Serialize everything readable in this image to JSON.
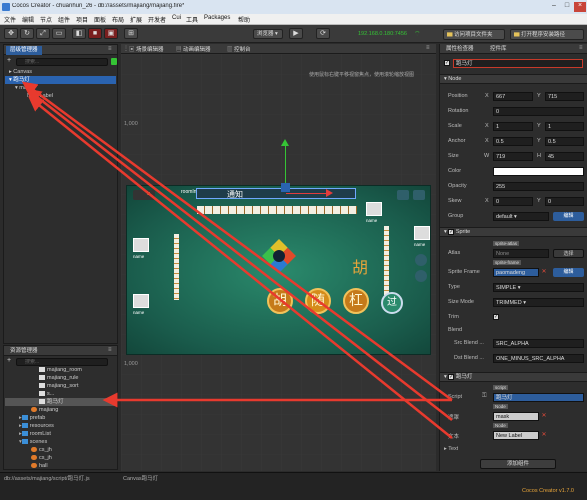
{
  "app": {
    "title": "Cocos Creator - chuanhun_26 - db://assets/majiang/majiang.fire*",
    "version": "Cocos Creator v1.7.0"
  },
  "menu": [
    "文件",
    "编辑",
    "节点",
    "组件",
    "项目",
    "面板",
    "布局",
    "扩展",
    "开发者",
    "Cui",
    "工具",
    "Packages",
    "帮助"
  ],
  "toolbar": {
    "browser_label": "浏览器",
    "ip": "192.168.0.180:7456",
    "open_project_label": "访问项目文件夹",
    "open_app_label": "打开程序安装路径"
  },
  "hierarchy": {
    "tab": "层级管理器",
    "search_placeholder": "搜索...",
    "nodes": [
      {
        "label": "Canvas",
        "indent": 0,
        "arrow": "▸"
      },
      {
        "label": "跑马灯",
        "indent": 0,
        "arrow": "▾",
        "selected": true
      },
      {
        "label": "mask",
        "indent": 1,
        "arrow": "▾"
      },
      {
        "label": "New Label",
        "indent": 2,
        "arrow": ""
      }
    ]
  },
  "assets": {
    "tab": "资源管理器",
    "search_placeholder": "搜索...",
    "items": [
      {
        "label": "majiang_room",
        "indent": 3,
        "kind": "script"
      },
      {
        "label": "majiang_rule",
        "indent": 3,
        "kind": "script"
      },
      {
        "label": "majiang_sort",
        "indent": 3,
        "kind": "script"
      },
      {
        "label": "s...",
        "indent": 3,
        "kind": "script"
      },
      {
        "label": "跑马灯",
        "indent": 3,
        "kind": "script",
        "selected": true
      },
      {
        "label": "majiang",
        "indent": 2,
        "kind": "fire"
      },
      {
        "label": "prefab",
        "indent": 1,
        "kind": "folder"
      },
      {
        "label": "resources",
        "indent": 1,
        "kind": "folder"
      },
      {
        "label": "roomList",
        "indent": 1,
        "kind": "folder"
      },
      {
        "label": "scenes",
        "indent": 1,
        "kind": "folder-open"
      },
      {
        "label": "cs_jh",
        "indent": 2,
        "kind": "fire"
      },
      {
        "label": "cs_jh",
        "indent": 2,
        "kind": "fire"
      },
      {
        "label": "hall",
        "indent": 2,
        "kind": "fire"
      }
    ],
    "path": "db://assets/majiang/script/跑马灯.js"
  },
  "scene": {
    "tabs": [
      "场景编辑器",
      "动画编辑器",
      "控制台"
    ],
    "hint": "使用鼠标右键平移视窗焦点，使用滚轮缩放视图",
    "axis_label": "1,000",
    "axis_label_2": "1,000",
    "notice": "通知",
    "canvas_label": "Canvas跑马灯",
    "score_labels": [
      "5",
      "name",
      "name",
      "name",
      "name"
    ],
    "game_labels": [
      "胡",
      "随",
      "杠",
      "胡",
      "过"
    ],
    "room_info": "roomInfo"
  },
  "inspector": {
    "tabs": [
      "属性检查器",
      "控件库"
    ],
    "node_name": "跑马灯",
    "section_node": "Node",
    "position": {
      "x": "667",
      "y": "715"
    },
    "rotation": "0",
    "scale": {
      "x": "1",
      "y": "1"
    },
    "anchor": {
      "x": "0.5",
      "y": "0.5"
    },
    "size": {
      "w": "719",
      "h": "45"
    },
    "color_label": "Color",
    "opacity": "255",
    "skew": {
      "x": "0",
      "y": "0"
    },
    "group": "default",
    "edit_label": "编辑",
    "section_sprite": "Sprite",
    "atlas_label": "Atlas",
    "atlas_tag": "sprite-atlas",
    "atlas_value": "None",
    "atlas_btn": "选择",
    "sprite_frame_label": "Sprite Frame",
    "sprite_frame_tag": "sprite-frame",
    "sprite_frame_value": "paomadeng",
    "sprite_frame_btn": "编辑",
    "type_label": "Type",
    "type_value": "SIMPLE",
    "size_mode_label": "Size Mode",
    "size_mode_value": "TRIMMED",
    "trim_label": "Trim",
    "blend_label": "Blend",
    "src_blend_label": "Src Blend ...",
    "src_blend_value": "SRC_ALPHA",
    "dst_blend_label": "Dst Blend ...",
    "dst_blend_value": "ONE_MINUS_SRC_ALPHA",
    "section_script": "跑马灯",
    "script_label": "Script",
    "script_tag": "script",
    "script_value": "跑马灯",
    "mask_label": "遮罩",
    "mask_tag": "Node",
    "mask_value": "mask",
    "text_label": "文本",
    "text_tag": "Node",
    "text_value": "New Label",
    "section_text": "Text",
    "add_component": "添加组件",
    "field_labels": {
      "position": "Position",
      "rotation": "Rotation",
      "scale": "Scale",
      "anchor": "Anchor",
      "size": "Size",
      "opacity": "Opacity",
      "skew": "Skew",
      "group": "Group"
    },
    "axis": {
      "x": "X",
      "y": "Y",
      "w": "W",
      "h": "H"
    }
  },
  "colors": {
    "accent": "#2d5d9c",
    "selected": "#2a63b0",
    "game_bg": "#1e6b5a",
    "arrow": "#e83a2e"
  }
}
